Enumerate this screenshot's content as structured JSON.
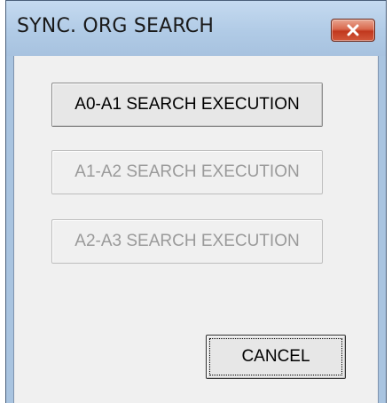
{
  "window": {
    "title": "SYNC. ORG SEARCH",
    "close_icon": "close-x-icon"
  },
  "buttons": {
    "a0_a1": {
      "label": "A0-A1 SEARCH EXECUTION",
      "enabled": true
    },
    "a1_a2": {
      "label": "A1-A2 SEARCH EXECUTION",
      "enabled": false
    },
    "a2_a3": {
      "label": "A2-A3 SEARCH EXECUTION",
      "enabled": false
    },
    "cancel": {
      "label": "CANCEL",
      "enabled": true,
      "focused": true
    }
  },
  "colors": {
    "titlebar": "#b1cbe6",
    "close_button": "#c1381e",
    "client_background": "#f0f0f0",
    "disabled_text": "#9a9a9a"
  }
}
